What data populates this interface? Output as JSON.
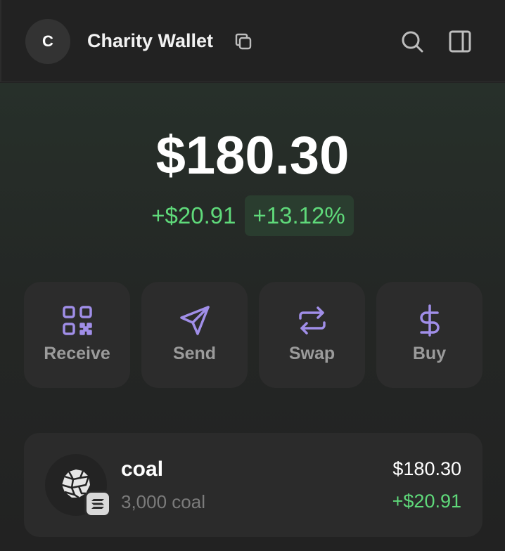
{
  "header": {
    "avatar_initial": "C",
    "wallet_name": "Charity Wallet",
    "icons": {
      "copy": "copy-icon",
      "search": "search-icon",
      "sidebar": "sidebar-panel-icon"
    }
  },
  "balance": {
    "total": "$180.30",
    "change_amount": "+$20.91",
    "change_percent": "+13.12%"
  },
  "actions": [
    {
      "label": "Receive",
      "icon": "qr-code-icon"
    },
    {
      "label": "Send",
      "icon": "send-arrow-icon"
    },
    {
      "label": "Swap",
      "icon": "swap-arrows-icon"
    },
    {
      "label": "Buy",
      "icon": "dollar-sign-icon"
    }
  ],
  "tokens": [
    {
      "name": "coal",
      "amount": "3,000 coal",
      "value": "$180.30",
      "change": "+$20.91",
      "icon": "coal-token-icon",
      "chain_icon": "solana-badge-icon"
    }
  ],
  "colors": {
    "background": "#222222",
    "accent": "#a08ee8",
    "positive": "#5fd97a",
    "card": "#2c2c2c",
    "muted_text": "#9b9b9b"
  }
}
